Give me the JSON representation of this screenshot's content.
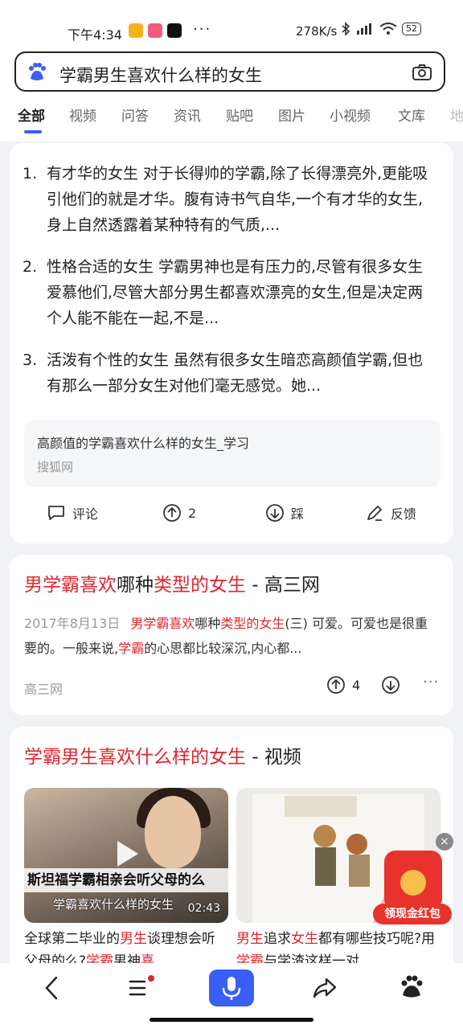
{
  "status_bar": {
    "time": "下午4:34",
    "more": "···",
    "speed": "278K/s",
    "battery": "52"
  },
  "search": {
    "query": "学霸男生喜欢什么样的女生",
    "logo_icon": "baidu-paw-icon",
    "camera_icon": "camera-icon"
  },
  "tabs": [
    "全部",
    "视频",
    "问答",
    "资讯",
    "贴吧",
    "图片",
    "小视频",
    "文库",
    "地"
  ],
  "answer_card": {
    "items": [
      {
        "num": "1.",
        "text": "有才华的女生 对于长得帅的学霸,除了长得漂亮外,更能吸引他们的就是才华。腹有诗书气自华,一个有才华的女生,身上自然透露着某种特有的气质,..."
      },
      {
        "num": "2.",
        "text": "性格合适的女生 学霸男神也是有压力的,尽管有很多女生爱慕他们,尽管大部分男生都喜欢漂亮的女生,但是决定两个人能不能在一起,不是..."
      },
      {
        "num": "3.",
        "text": "活泼有个性的女生 虽然有很多女生暗恋高颜值学霸,但也有那么一部分女生对他们毫无感觉。她..."
      }
    ],
    "source_title": "高颜值的学霸喜欢什么样的女生_学习",
    "source_site": "搜狐网",
    "actions": {
      "comment": "评论",
      "like_count": "2",
      "dislike": "踩",
      "feedback": "反馈"
    }
  },
  "result_card": {
    "title_parts": [
      "男学霸喜欢",
      "哪种",
      "类型的女生",
      " - 高三网"
    ],
    "date": "2017年8月13日",
    "snippet_parts": [
      "男学霸喜欢",
      "哪种",
      "类型的女生",
      "(三) 可爱。可爱也是很重要的。一般来说,",
      "学霸",
      "的心思都比较深沉,内心都..."
    ],
    "site": "高三网",
    "like_count": "4",
    "more": "···"
  },
  "video_card": {
    "title_parts": [
      "学霸男生喜欢什么样的女生",
      " - 视频"
    ],
    "videos": [
      {
        "band_text": "斯坦福学霸相亲会听父母的么",
        "subtitle": "学霸喜欢什么样的女生",
        "duration": "02:43",
        "title_parts": [
          "全球第二毕业的",
          "男生",
          "谈理想会听父母的么?",
          "学霸",
          "男神",
          "喜"
        ]
      },
      {
        "band_text": "",
        "subtitle": "",
        "duration": "",
        "title_parts": [
          "男生",
          "追求",
          "女生",
          "都有哪些技巧呢?用",
          "学霸",
          "与学渣这样一对"
        ]
      }
    ]
  },
  "floating_redpacket": {
    "label": "领现金红包",
    "close": "×"
  },
  "colors": {
    "accent": "#3a5ff5",
    "highlight_red": "#e1262e"
  }
}
